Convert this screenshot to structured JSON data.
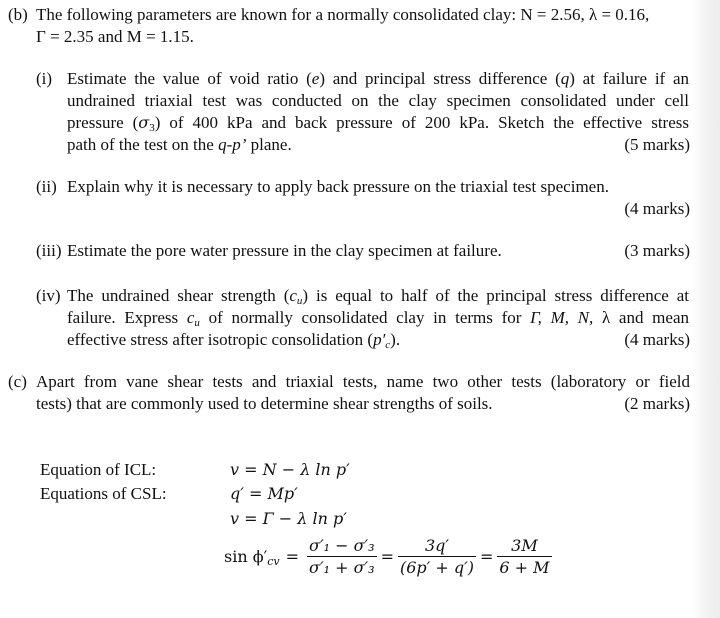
{
  "part_b": {
    "label": "(b)",
    "intro_line1": "The following parameters are known for a normally consolidated clay: N = 2.56, λ = 0.16,",
    "intro_line2": "Γ = 2.35 and M = 1.15."
  },
  "questions": [
    {
      "label": "(i)",
      "lines": [
        "Estimate the value of void ratio (e) and principal stress difference (q) at failure if an",
        "undrained triaxial test was conducted on the clay specimen consolidated under cell",
        "pressure (σ₃) of 400 kPa and back pressure of 200 kPa.  Sketch the effective stress",
        "path of the test on the q-p’ plane."
      ],
      "line1_parts": [
        "Estimate the value of void ratio (",
        "e",
        ") and principal stress difference (",
        "q",
        ") at failure if an"
      ],
      "line3_parts": [
        "pressure (",
        "σ",
        "3",
        ") of 400 kPa and back pressure of 200 kPa.  Sketch the effective stress"
      ],
      "line4_parts": [
        "path of the test on the ",
        "q-p’",
        " plane."
      ],
      "marks": "(5 marks)"
    },
    {
      "label": "(ii)",
      "lines": [
        "Explain why it is necessary to apply back pressure on the triaxial test specimen."
      ],
      "marks": "(4 marks)"
    },
    {
      "label": "(iii)",
      "lines": [
        "Estimate the pore water pressure in the clay specimen at failure."
      ],
      "marks": "(3 marks)"
    },
    {
      "label": "(iv)",
      "line1_parts": [
        "The undrained shear strength (",
        "c",
        "u",
        ") is equal to half of the principal stress difference at"
      ],
      "line2_parts": [
        "failure. Express ",
        "c",
        "u",
        " of normally consolidated clay in terms for ",
        "Γ, M, N,",
        " λ and mean"
      ],
      "line3_parts": [
        "effective stress after isotropic consolidation (",
        "p′",
        "c",
        ")."
      ],
      "marks": "(4 marks)"
    }
  ],
  "part_c": {
    "label": "(c)",
    "line1": "Apart from vane shear tests and triaxial tests, name two other tests (laboratory or field",
    "line2": "tests) that are commonly used to determine shear strengths of soils.",
    "marks": "(2 marks)"
  },
  "equations": {
    "icl_label": "Equation of ICL:",
    "csl_label": "Equations of CSL:",
    "icl": "v = N − λ ln p′",
    "csl1": "q′ = Mp′",
    "csl2": "v = Γ − λ ln p′",
    "sin_lhs": "sin ϕ′",
    "sin_lhs_sub": "cv",
    "frac1_num": "σ′₁ − σ′₃",
    "frac1_den": "σ′₁ + σ′₃",
    "frac2_num": "3q′",
    "frac2_den": "(6p′ + q′)",
    "frac3_num": "3M",
    "frac3_den": "6 + M",
    "equals": "="
  }
}
